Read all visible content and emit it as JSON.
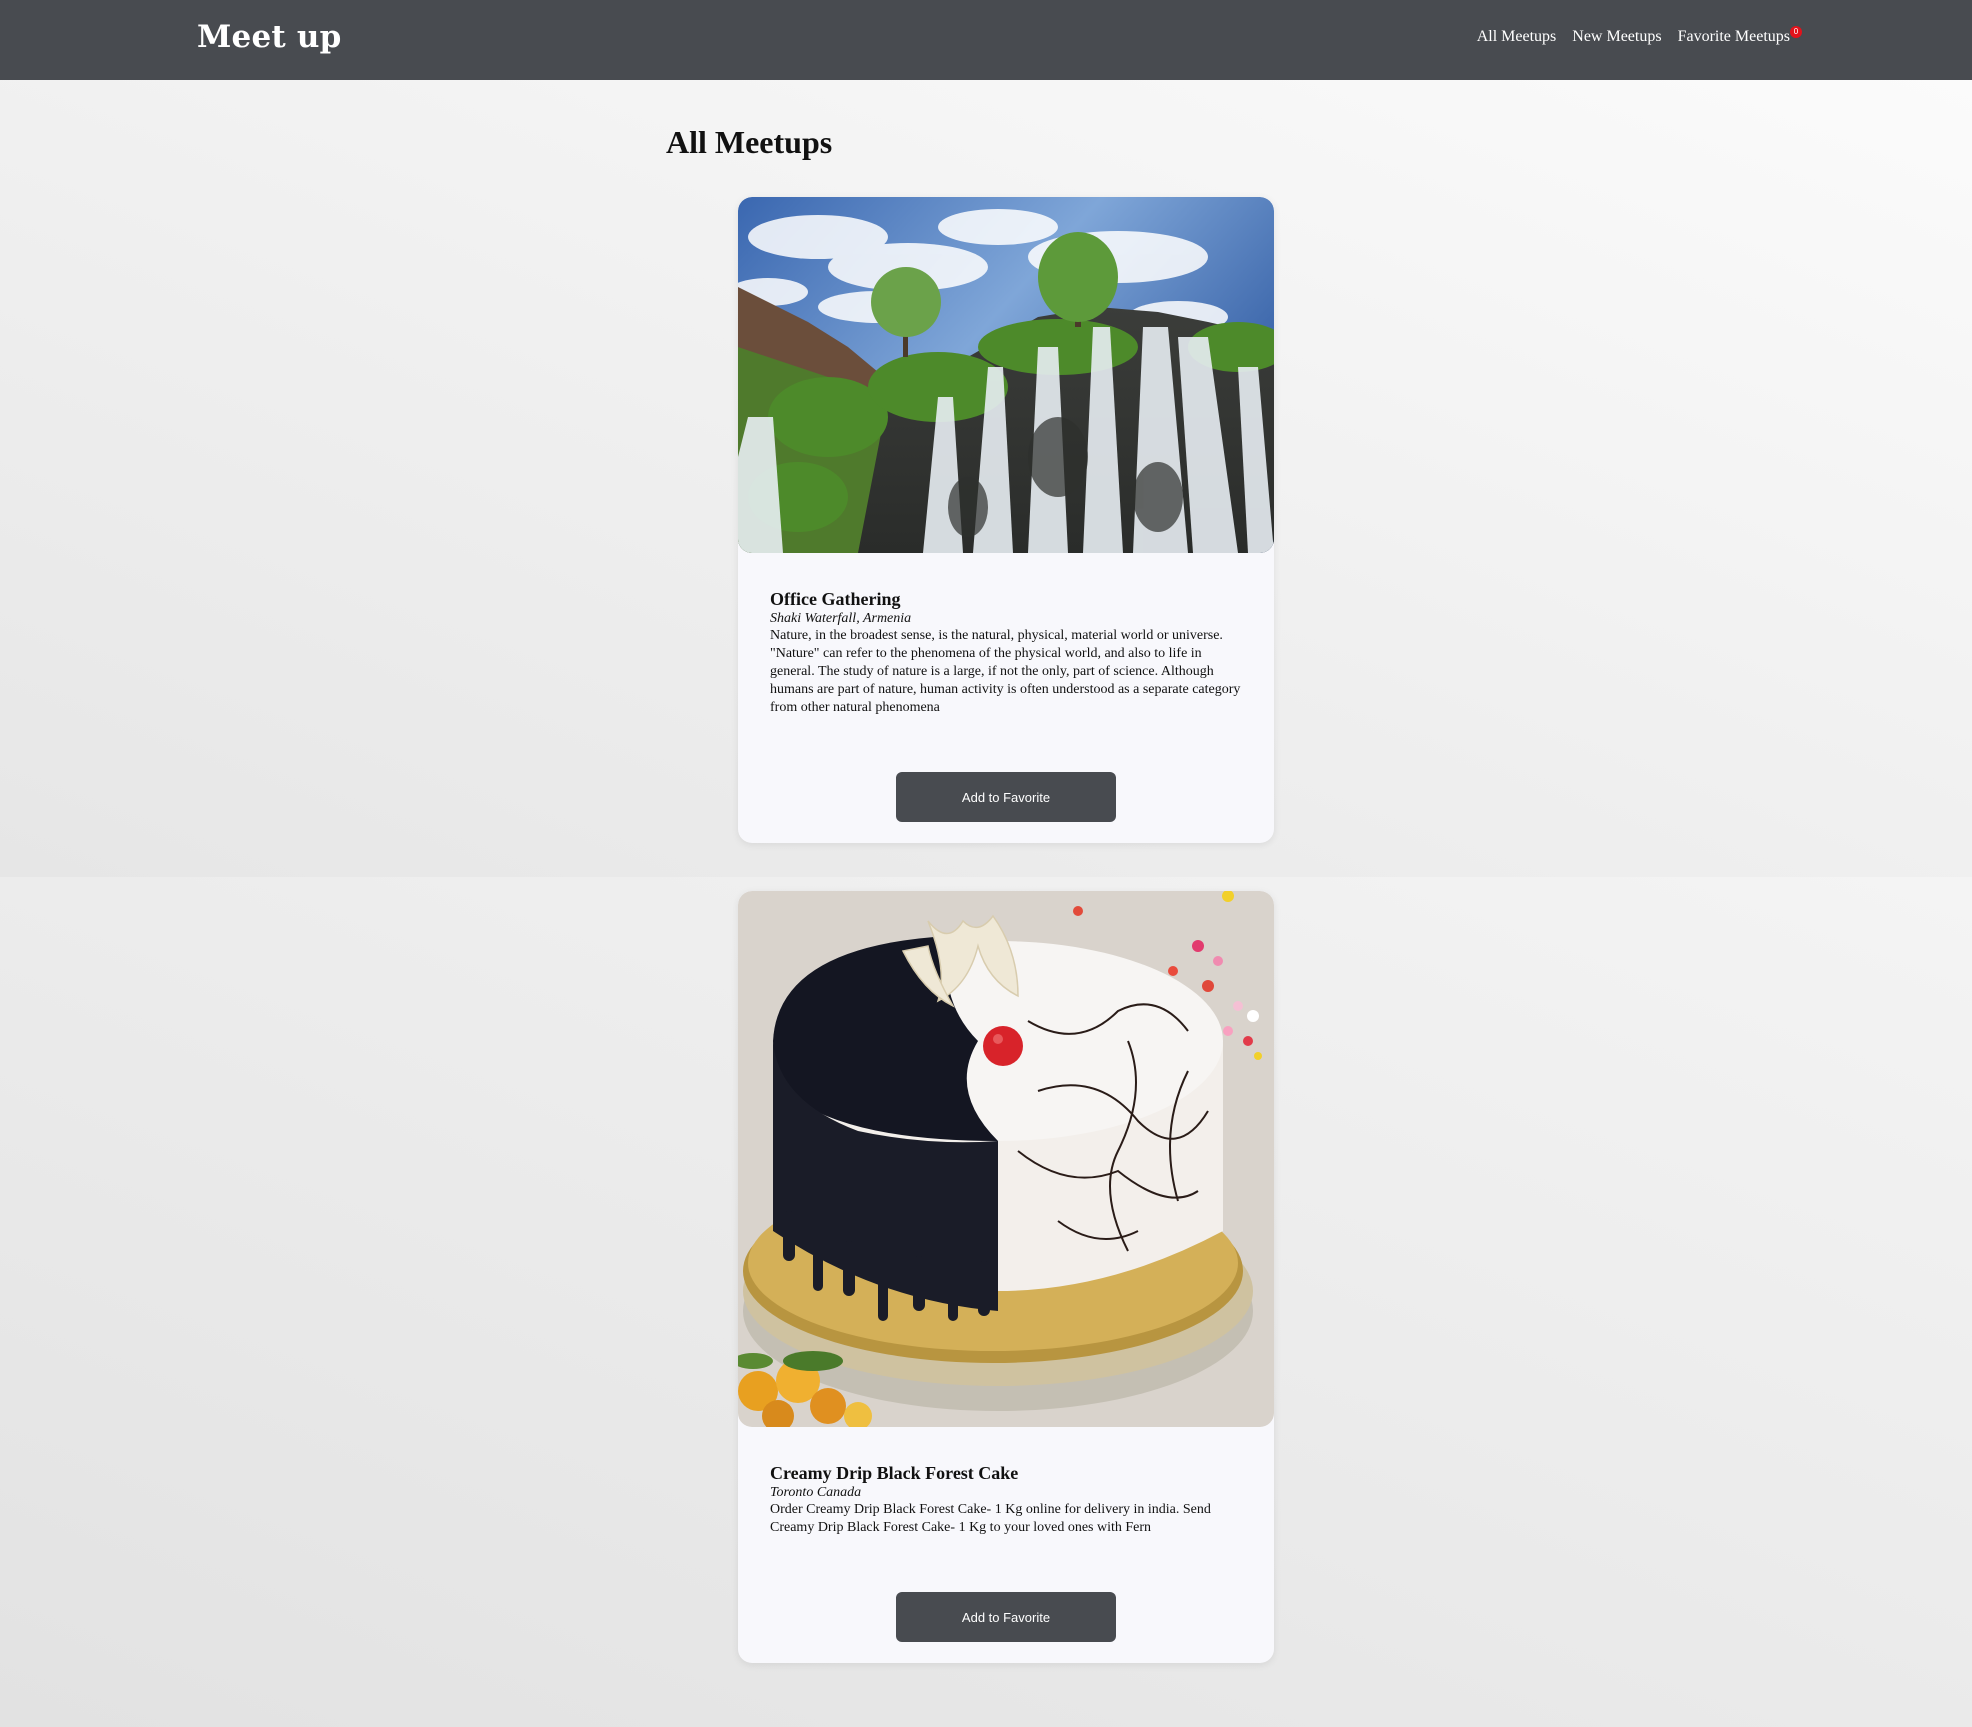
{
  "header": {
    "brand": "Meet up",
    "nav": [
      {
        "label": "All Meetups"
      },
      {
        "label": "New Meetups"
      },
      {
        "label": "Favorite Meetups",
        "badge": "0"
      }
    ]
  },
  "main": {
    "title": "All Meetups",
    "meetups": [
      {
        "title": "Office Gathering",
        "address": "Shaki Waterfall, Armenia",
        "description": "Nature, in the broadest sense, is the natural, physical, material world or universe. \"Nature\" can refer to the phenomena of the physical world, and also to life in general. The study of nature is a large, if not the only, part of science. Although humans are part of nature, human activity is often understood as a separate category from other natural phenomena",
        "button": "Add to Favorite",
        "image_icon": "waterfall-photo"
      },
      {
        "title": "Creamy Drip Black Forest Cake",
        "address": "Toronto Canada",
        "description": "Order Creamy Drip Black Forest Cake- 1 Kg online for delivery in india. Send Creamy Drip Black Forest Cake- 1 Kg to your loved ones with Fern",
        "button": "Add to Favorite",
        "image_icon": "cake-photo"
      }
    ]
  },
  "colors": {
    "navbar": "#484b50",
    "button": "#484b50",
    "badge": "#e3121b",
    "card": "#f8f8fc"
  }
}
